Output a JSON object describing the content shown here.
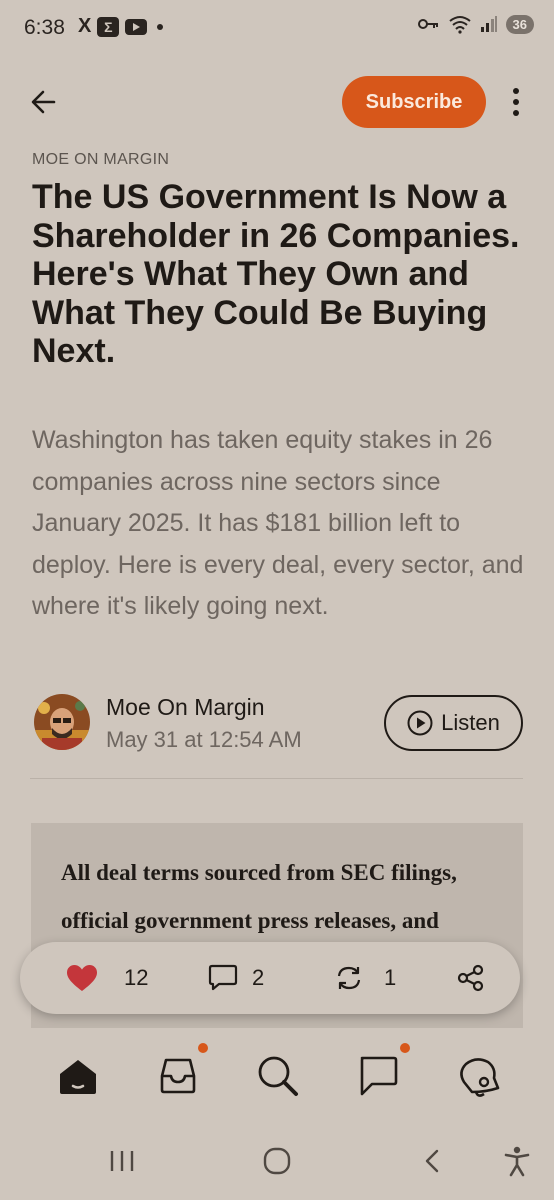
{
  "status_bar": {
    "time": "6:38",
    "x_icon": "X",
    "sigma": "Σ",
    "battery": "36"
  },
  "header": {
    "subscribe_label": "Subscribe"
  },
  "article": {
    "publication": "MOE ON MARGIN",
    "title": "The US Government Is Now a Shareholder in 26 Companies. Here's What They Own and What They Could Be Buying Next.",
    "subtitle": "Washington has taken equity stakes in 26 companies across nine sectors since January 2025. It has $181 billion left to deploy. Here is every deal, every sector, and where it's likely going next.",
    "author": "Moe On Margin",
    "date": "May 31 at 12:54 AM",
    "listen_label": "Listen",
    "quote": "All deal terms sourced from SEC filings, official government press releases, and company Foreign Relations Government"
  },
  "actions": {
    "likes": "12",
    "comments": "2",
    "restacks": "1"
  },
  "colors": {
    "accent": "#d7571a",
    "background": "#cfc6bd",
    "text": "#1f1a16",
    "like": "#c4363b"
  }
}
